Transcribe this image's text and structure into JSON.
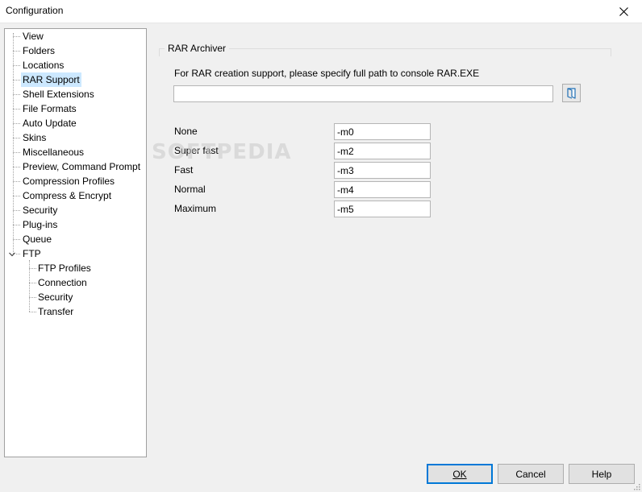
{
  "window": {
    "title": "Configuration"
  },
  "tree": {
    "items": [
      {
        "label": "View"
      },
      {
        "label": "Folders"
      },
      {
        "label": "Locations"
      },
      {
        "label": "RAR Support"
      },
      {
        "label": "Shell Extensions"
      },
      {
        "label": "File Formats"
      },
      {
        "label": "Auto Update"
      },
      {
        "label": "Skins"
      },
      {
        "label": "Miscellaneous"
      },
      {
        "label": "Preview, Command Prompt"
      },
      {
        "label": "Compression Profiles"
      },
      {
        "label": "Compress & Encrypt"
      },
      {
        "label": "Security"
      },
      {
        "label": "Plug-ins"
      },
      {
        "label": "Queue"
      },
      {
        "label": "FTP"
      }
    ],
    "ftp_children": [
      {
        "label": "FTP Profiles"
      },
      {
        "label": "Connection"
      },
      {
        "label": "Security"
      },
      {
        "label": "Transfer"
      }
    ],
    "selected": "RAR Support"
  },
  "rar": {
    "group_title": "RAR Archiver",
    "description": "For RAR creation support, please specify full path to console RAR.EXE",
    "path_value": "",
    "levels": [
      {
        "label": "None",
        "value": "-m0"
      },
      {
        "label": "Super fast",
        "value": "-m2"
      },
      {
        "label": "Fast",
        "value": "-m3"
      },
      {
        "label": "Normal",
        "value": "-m4"
      },
      {
        "label": "Maximum",
        "value": "-m5"
      }
    ]
  },
  "watermark": "SOFTPEDIA",
  "buttons": {
    "ok_label": "OK",
    "cancel_label": "Cancel",
    "help_label": "Help"
  },
  "icons": {
    "close": "close-icon",
    "browse": "folder-browse-icon",
    "expander": "chevron-down-icon"
  },
  "colors": {
    "selection": "#cce8ff",
    "default_button_border": "#0078d7",
    "browse_icon": "#1f6fb5"
  }
}
